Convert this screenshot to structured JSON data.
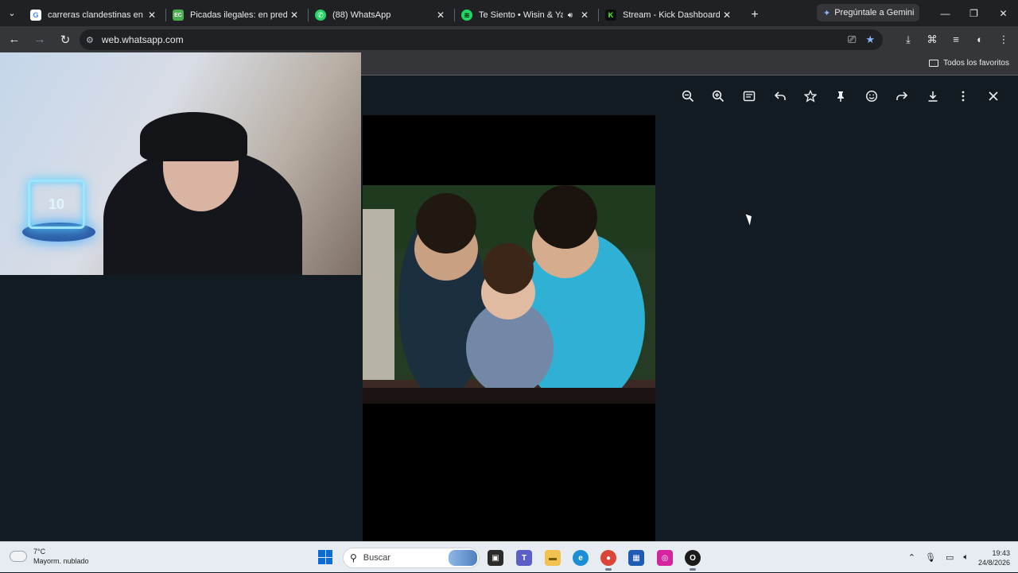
{
  "tabs": [
    {
      "label": "carreras clandestinas en el jag",
      "fav_color": "#ffffff",
      "fav_text": "G",
      "active": false
    },
    {
      "label": "Picadas ilegales: en predio mu",
      "fav_color": "#4cae4f",
      "fav_text": "EC",
      "active": false
    },
    {
      "label": "(88) WhatsApp",
      "fav_color": "#25d366",
      "fav_text": "✆",
      "active": true
    },
    {
      "label": "Te Siento • Wisin & Yandel",
      "fav_color": "#1ed760",
      "fav_text": "≋",
      "active": false
    },
    {
      "label": "Stream - Kick Dashboard",
      "fav_color": "#53fc18",
      "fav_text": "K",
      "active": false
    }
  ],
  "tab_close": "✕",
  "gemini_label": "Pregúntale a Gemini",
  "url": "web.whatsapp.com",
  "bookmarks_folder": "Todos los favoritos",
  "viewer_icons": [
    "zoom-out-icon",
    "zoom-in-icon",
    "message-icon",
    "reply-icon",
    "star-icon",
    "pin-icon",
    "emoji-icon",
    "forward-icon",
    "download-icon",
    "more-icon",
    "close-icon"
  ],
  "taskbar": {
    "temperature": "7°C",
    "weather_desc": "Mayorm. nublado",
    "search_placeholder": "Buscar",
    "time": "19:43",
    "date": "24/8/2026"
  },
  "colors": {
    "whatsapp_bg": "#111b21",
    "chrome_tab_bar": "#202124",
    "chrome_toolbar": "#35363a",
    "taskbar": "#e7ecf2"
  }
}
